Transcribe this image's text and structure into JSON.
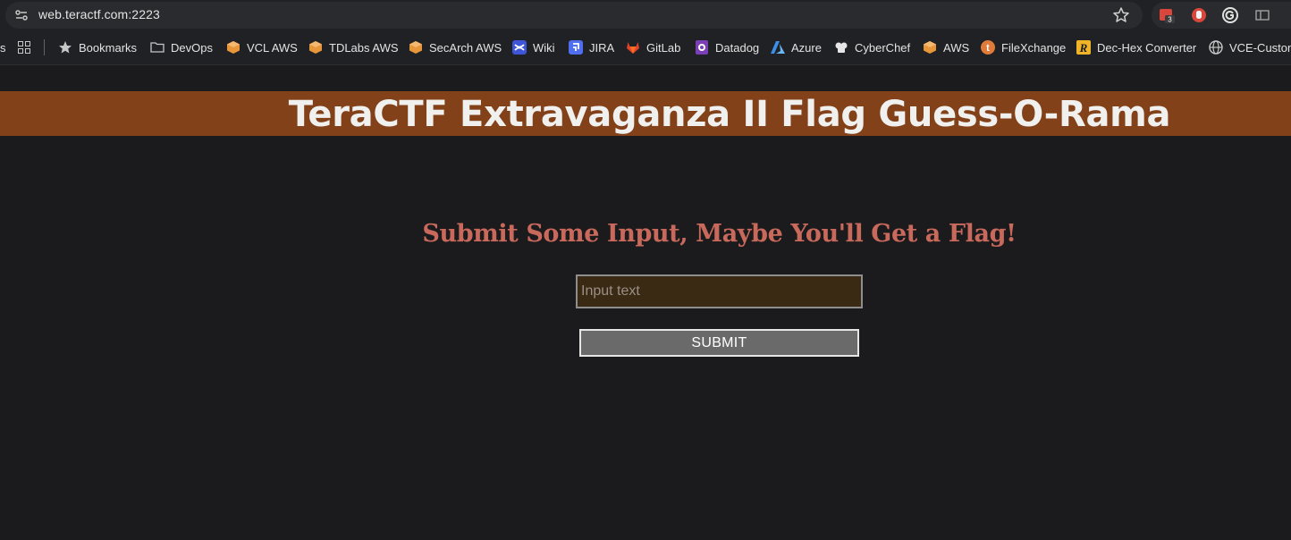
{
  "browser": {
    "url": "web.teractf.com:2223",
    "extensions": [
      {
        "icon": "calendar-extension-icon",
        "badge": "3"
      },
      {
        "icon": "hand-stop-extension-icon"
      },
      {
        "icon": "grammarly-extension-icon"
      },
      {
        "icon": "reader-extension-icon"
      }
    ],
    "bookmarks": [
      {
        "label": "Bookmarks",
        "icon": "star-icon"
      },
      {
        "label": "DevOps",
        "icon": "folder-icon"
      },
      {
        "label": "VCL AWS",
        "icon": "aws-box-icon"
      },
      {
        "label": "TDLabs AWS",
        "icon": "aws-box-icon"
      },
      {
        "label": "SecArch AWS",
        "icon": "aws-box-icon"
      },
      {
        "label": "Wiki",
        "icon": "confluence-icon"
      },
      {
        "label": "JIRA",
        "icon": "jira-icon"
      },
      {
        "label": "GitLab",
        "icon": "gitlab-icon"
      },
      {
        "label": "Datadog",
        "icon": "datadog-icon"
      },
      {
        "label": "Azure",
        "icon": "azure-icon"
      },
      {
        "label": "CyberChef",
        "icon": "cyberchef-icon"
      },
      {
        "label": "AWS",
        "icon": "aws-box-icon"
      },
      {
        "label": "FileXchange",
        "icon": "filexchange-icon"
      },
      {
        "label": "Dec-Hex Converter",
        "icon": "r-logo-icon"
      },
      {
        "label": "VCE-Custom",
        "icon": "globe-icon"
      }
    ]
  },
  "page": {
    "title": "TeraCTF Extravaganza II Flag Guess-O-Rama",
    "prompt": "Submit Some Input, Maybe You'll Get a Flag!",
    "input_placeholder": "Input text",
    "submit_label": "SUBMIT"
  },
  "colors": {
    "banner": "#83411a",
    "prompt": "#c9695c",
    "background": "#1b1b1d",
    "input_bg": "#3a2a14",
    "button_bg": "#6a6a6a"
  }
}
